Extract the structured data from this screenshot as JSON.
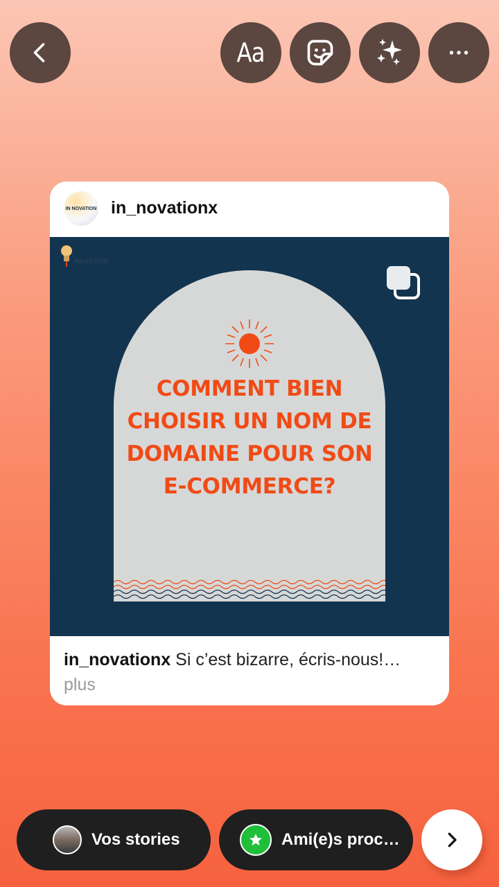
{
  "toolbar": {
    "back_icon": "chevron-left-icon",
    "text_tool_label": "Aa",
    "sticker_icon": "sticker-icon",
    "effects_icon": "sparkles-icon",
    "more_icon": "more-horizontal-icon"
  },
  "post": {
    "username": "in_novationx",
    "avatar_text": "IN NOVATION",
    "image_logo_text": "NOVATION",
    "headline_lines": [
      "COMMENT BIEN",
      "CHOISIR UN NOM DE",
      "DOMAINE POUR SON",
      "E-COMMERCE?"
    ],
    "caption_username": "in_novationx",
    "caption_text": "Si c’est bizarre, écris-nous!…",
    "caption_more": "plus"
  },
  "share": {
    "your_story_label": "Vos stories",
    "close_friends_label": "Ami(e)s proc…",
    "send_icon": "chevron-right-icon"
  },
  "colors": {
    "background_top": "#fbc6b4",
    "background_bottom": "#f6623f",
    "image_background": "#12344f",
    "headline": "#f04b16",
    "close_friends_green": "#1fbf3a"
  }
}
